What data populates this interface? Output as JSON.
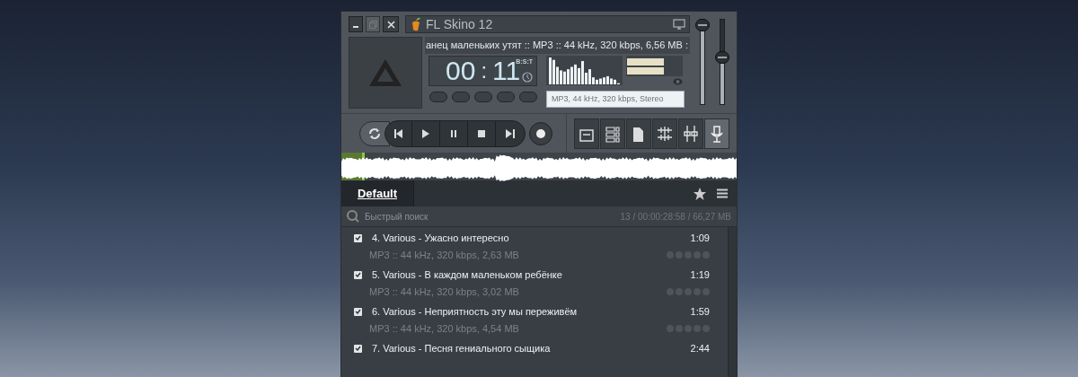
{
  "player": {
    "title": "FL Skino 12",
    "marquee": "анец маленьких утят :: MP3 :: 44 kHz, 320 kbps, 6,56 MB :",
    "time": {
      "minutes": "00",
      "separator": ":",
      "seconds": "11",
      "mode": "B:S:T"
    },
    "format": "MP3, 44 kHz, 320 kbps, Stereo",
    "volume": {
      "level": 0.93
    },
    "balance": {
      "level": 0.55
    },
    "progress": {
      "level": 0.06
    }
  },
  "playlist": {
    "tabs": [
      {
        "label": "Default",
        "selected": true
      }
    ],
    "search": {
      "placeholder": "Быстрый поиск"
    },
    "summary": "13 / 00:00:28:58 / 66,27 MB",
    "tracks": [
      {
        "title": "4. Various - Ужасно интересно",
        "info": "MP3 :: 44 kHz, 320 kbps, 2,63 MB",
        "duration": "1:09",
        "checked": true,
        "stars": 0
      },
      {
        "title": "5. Various - В каждом маленьком ребёнке",
        "info": "MP3 :: 44 kHz, 320 kbps, 3,02 MB",
        "duration": "1:19",
        "checked": true,
        "stars": 0
      },
      {
        "title": "6. Various - Неприятность эту мы переживём",
        "info": "MP3 :: 44 kHz, 320 kbps, 4,54 MB",
        "duration": "1:59",
        "checked": true,
        "stars": 0
      },
      {
        "title": "7. Various - Песня гениального сыщика",
        "duration": "2:44",
        "checked": true
      }
    ]
  }
}
